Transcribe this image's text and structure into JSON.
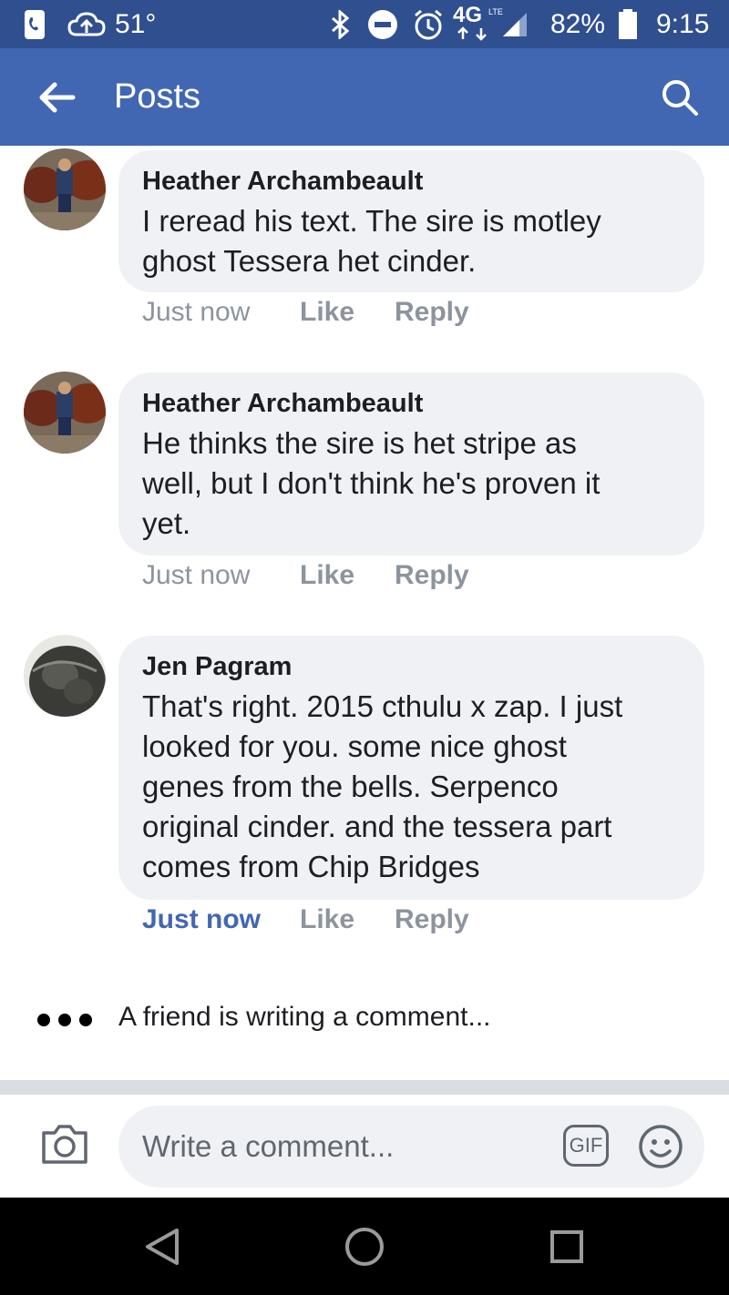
{
  "status_bar": {
    "temperature": "51°",
    "network": "4G",
    "network_sub": "LTE",
    "battery": "82%",
    "time": "9:15"
  },
  "header": {
    "title": "Posts"
  },
  "comments": [
    {
      "author": "Heather Archambeault",
      "lines": [
        "I reread his text. The sire is motley",
        "ghost Tessera het cinder."
      ],
      "time": "Just now",
      "like": "Like",
      "reply": "Reply"
    },
    {
      "author": "Heather Archambeault",
      "lines": [
        "He thinks the sire is het stripe as",
        "well, but I don't think he's proven it",
        "yet."
      ],
      "time": "Just now",
      "like": "Like",
      "reply": "Reply"
    },
    {
      "author": "Jen Pagram",
      "lines": [
        "That's right.  2015 cthulu x zap.  I just",
        "looked for you.  some nice ghost",
        "genes from the bells.  Serpenco",
        "original cinder.  and the tessera part",
        "comes from Chip Bridges"
      ],
      "time": "Just now",
      "like": "Like",
      "reply": "Reply"
    }
  ],
  "typing_indicator": "A friend is writing a comment...",
  "composer": {
    "placeholder": "Write a comment...",
    "gif_label": "GIF"
  },
  "colors": {
    "status_bar": "#2f4f8f",
    "header": "#4267b2",
    "bubble": "#f0f1f4",
    "action_text": "#8d949e",
    "time_active": "#4267b2"
  }
}
